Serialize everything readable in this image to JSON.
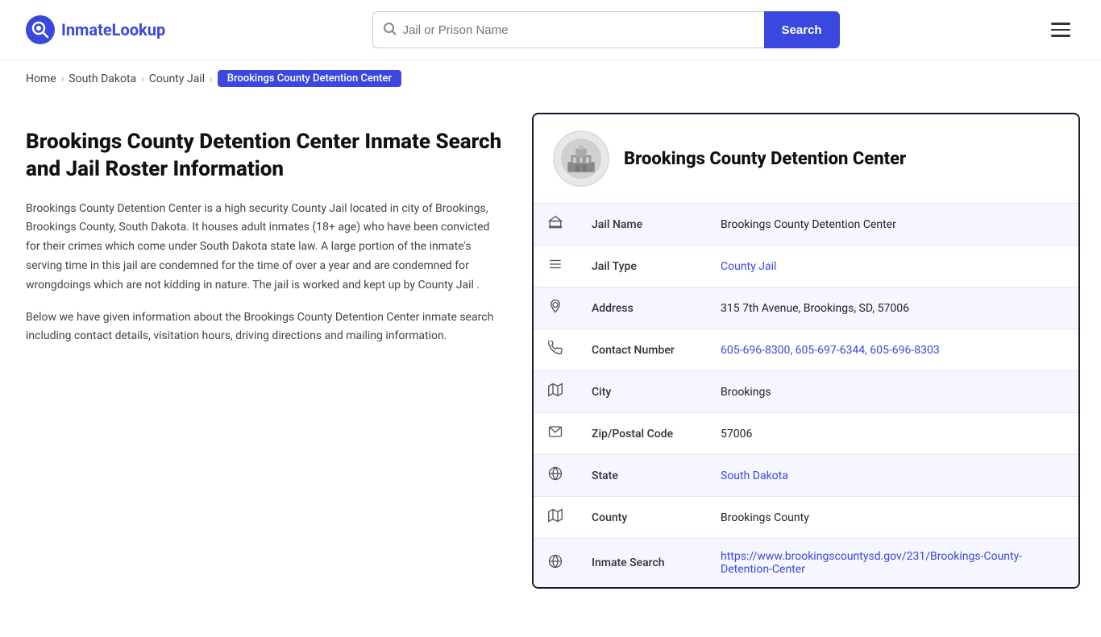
{
  "header": {
    "logo_icon": "Q",
    "logo_name_prefix": "Inmate",
    "logo_name_suffix": "Lookup",
    "search_placeholder": "Jail or Prison Name",
    "search_button_label": "Search"
  },
  "breadcrumb": {
    "home": "Home",
    "state": "South Dakota",
    "type": "County Jail",
    "current": "Brookings County Detention Center"
  },
  "left": {
    "heading": "Brookings County Detention Center Inmate Search and Jail Roster Information",
    "para1": "Brookings County Detention Center is a high security County Jail located in city of Brookings, Brookings County, South Dakota. It houses adult inmates (18+ age) who have been convicted for their crimes which come under South Dakota state law. A large portion of the inmate's serving time in this jail are condemned for the time of over a year and are condemned for wrongdoings which are not kidding in nature. The jail is worked and kept up by County Jail .",
    "para2": "Below we have given information about the Brookings County Detention Center inmate search including contact details, visitation hours, driving directions and mailing information."
  },
  "card": {
    "title": "Brookings County Detention Center",
    "rows": [
      {
        "icon": "🏛",
        "label": "Jail Name",
        "value": "Brookings County Detention Center",
        "link": null
      },
      {
        "icon": "≡",
        "label": "Jail Type",
        "value": "County Jail",
        "link": "#"
      },
      {
        "icon": "📍",
        "label": "Address",
        "value": "315 7th Avenue, Brookings, SD, 57006",
        "link": null
      },
      {
        "icon": "📞",
        "label": "Contact Number",
        "value": "605-696-8300, 605-697-6344, 605-696-8303",
        "link": "#"
      },
      {
        "icon": "🗺",
        "label": "City",
        "value": "Brookings",
        "link": null
      },
      {
        "icon": "✉",
        "label": "Zip/Postal Code",
        "value": "57006",
        "link": null
      },
      {
        "icon": "🌐",
        "label": "State",
        "value": "South Dakota",
        "link": "#"
      },
      {
        "icon": "🗺",
        "label": "County",
        "value": "Brookings County",
        "link": null
      },
      {
        "icon": "🌐",
        "label": "Inmate Search",
        "value": "https://www.brookingscountysd.gov/231/Brookings-County-Detention-Center",
        "link": "https://www.brookingscountysd.gov/231/Brookings-County-Detention-Center"
      }
    ]
  },
  "colors": {
    "accent": "#3b48e0",
    "dark": "#1a1a2e"
  }
}
